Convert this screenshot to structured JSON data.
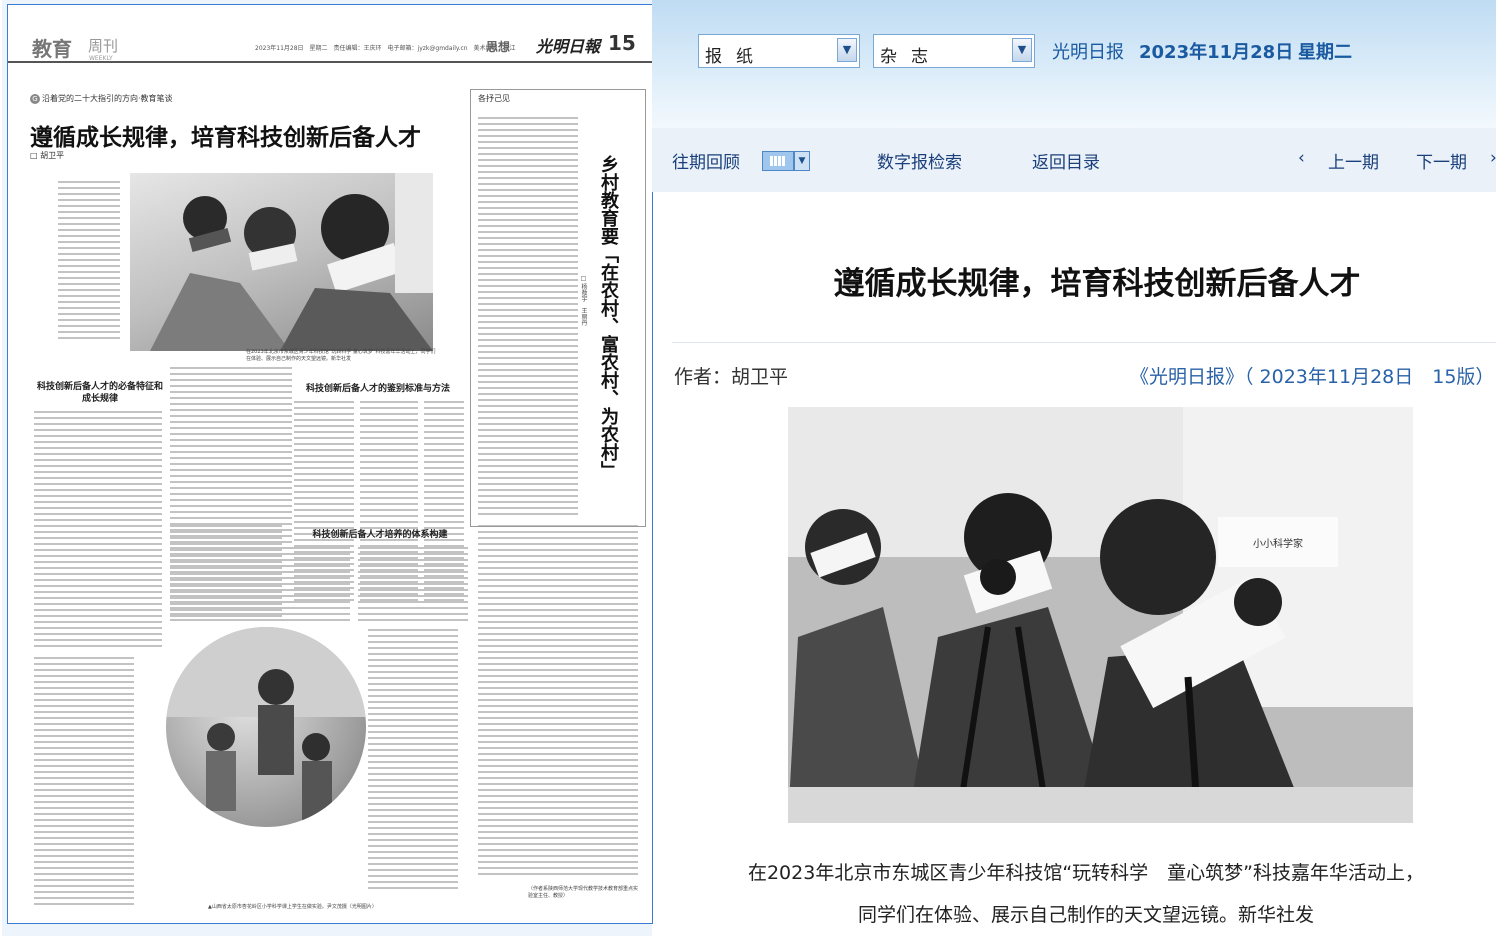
{
  "page": {
    "section_name": "教育",
    "weekly_label": "周刊",
    "weekly_en": "WEEKLY",
    "header_info": "2023年11月28日　星期二　责任编辑：王庆环　电子邮箱：jyzk@gmdaily.cn　美术编辑：张江",
    "section_tag": "思想",
    "paper_logo": "光明日報",
    "page_number": "15",
    "series_tag_icon": "G",
    "series_tag": "沿着党的二十大指引的方向·教育笔谈",
    "headline": "遵循成长规律，培育科技创新后备人才",
    "author": "□ 胡卫平",
    "photo_caption": "在2023年北京市东城区青少年科技馆“玩转科学 童心筑梦”科技嘉年华活动上，同学们在体验、展示自己制作的天文望远镜。新华社发",
    "sub_head_1": "科技创新后备人才的必备特征和成长规律",
    "sub_head_2": "科技创新后备人才的鉴别标准与方法",
    "sub_head_3": "科技创新后备人才培养的体系构建",
    "right_col_tag": "各抒己见",
    "vertical_title": "乡村教育要「在农村、富农村、为农村」",
    "vertical_authors": "□ 杨敖宇　王丽丹",
    "circle_caption": "▲山西省太原市杏花岭区小学科学课上学生在做实验。尹文茂摄（光明图片）",
    "footnote": "（作者系陕西师范大学现代教学技术教育部重点实验室主任、教授）"
  },
  "toolbar": {
    "newspaper_select": "报纸",
    "magazine_select": "杂志",
    "paper_name": "光明日报",
    "date": "2023年11月28日",
    "weekday": "星期二"
  },
  "nav": {
    "history": "往期回顾",
    "search": "数字报检索",
    "back": "返回目录",
    "prev_arrow": "‹",
    "prev": "上一期",
    "next": "下一期",
    "next_arrow": "›"
  },
  "article": {
    "title": "遵循成长规律，培育科技创新后备人才",
    "author": "作者：胡卫平",
    "source": "《光明日报》（ 2023年11月28日　15版）",
    "caption_line1": "在2023年北京市东城区青少年科技馆“玩转科学　童心筑梦”科技嘉年华活动上，",
    "caption_line2": "同学们在体验、展示自己制作的天文望远镜。新华社发",
    "photo_sign": "小小科学家"
  },
  "icons": {
    "dropdown": "chevron-down-icon",
    "calendar": "calendar-icon"
  },
  "colors": {
    "link_blue": "#1a5aa0",
    "nav_text": "#1a3f7a",
    "top_bar": "#bfdcf3",
    "frame_blue": "#3a7bd5"
  }
}
